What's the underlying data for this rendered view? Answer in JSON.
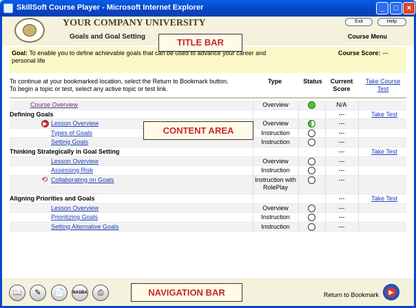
{
  "window": {
    "title": "SkillSoft Course Player - Microsoft Internet Explorer"
  },
  "header": {
    "company": "YOUR COMPANY UNIVERSITY",
    "course_title": "Goals and Goal Setting",
    "exit_label": "Exit",
    "help_label": "Help",
    "course_menu": "Course Menu"
  },
  "labels": {
    "title_bar": "TITLE BAR",
    "content_area": "CONTENT AREA",
    "navigation_bar": "NAVIGATION BAR"
  },
  "goal": {
    "label": "Goal:",
    "text": "To enable you to define achievable goals that can be used to advance your career and personal life",
    "score_label": "Course Score:",
    "score_value": "---"
  },
  "instructions": {
    "line1": "To continue at your bookmarked location, select the Return to Bookmark button.",
    "line2": "To begin a topic or test, select any active topic or test link."
  },
  "columns": {
    "type": "Type",
    "status": "Status",
    "current_score": "Current Score",
    "take_course_test": "Take Course Test"
  },
  "rows": [
    {
      "name": "Course Overview",
      "level": 0,
      "kind": "link-visited",
      "type": "Overview",
      "status": "complete",
      "score": "N/A",
      "take": ""
    },
    {
      "name": "Defining Goals",
      "level": 0,
      "kind": "section",
      "type": "",
      "status": "",
      "score": "---",
      "take": "Take Test"
    },
    {
      "name": "Lesson Overview",
      "level": 1,
      "kind": "link",
      "type": "Overview",
      "status": "in-progress",
      "score": "---",
      "take": "",
      "marker": "bookmark"
    },
    {
      "name": "Types of Goals",
      "level": 1,
      "kind": "link",
      "type": "Instruction",
      "status": "not-started",
      "score": "---",
      "take": ""
    },
    {
      "name": "Setting Goals",
      "level": 1,
      "kind": "link",
      "type": "Instruction",
      "status": "not-started",
      "score": "---",
      "take": ""
    },
    {
      "name": "Thinking Strategically in Goal Setting",
      "level": 0,
      "kind": "section",
      "type": "",
      "status": "",
      "score": "---",
      "take": "Take Test"
    },
    {
      "name": "Lesson Overview",
      "level": 1,
      "kind": "link",
      "type": "Overview",
      "status": "not-started",
      "score": "---",
      "take": ""
    },
    {
      "name": "Assessing Risk",
      "level": 1,
      "kind": "link",
      "type": "Instruction",
      "status": "not-started",
      "score": "---",
      "take": ""
    },
    {
      "name": "Collaborating on Goals",
      "level": 1,
      "kind": "link",
      "type": "Instruction with RolePlay",
      "status": "not-started",
      "score": "---",
      "take": "",
      "marker": "roleplay"
    },
    {
      "name": "Aligning Priorities and Goals",
      "level": 0,
      "kind": "section",
      "type": "",
      "status": "",
      "score": "---",
      "take": "Take Test"
    },
    {
      "name": "Lesson Overview",
      "level": 1,
      "kind": "link",
      "type": "Overview",
      "status": "not-started",
      "score": "---",
      "take": ""
    },
    {
      "name": "Prioritizing Goals",
      "level": 1,
      "kind": "link",
      "type": "Instruction",
      "status": "not-started",
      "score": "---",
      "take": ""
    },
    {
      "name": "Setting Alternative Goals",
      "level": 1,
      "kind": "link",
      "type": "Instruction",
      "status": "not-started",
      "score": "---",
      "take": ""
    }
  ],
  "nav": {
    "nasba_label": "NASBA",
    "return_label": "Return to Bookmark"
  },
  "colors": {
    "accent": "#1a3db5",
    "label_text": "#c4272d",
    "status_complete": "#4cc62a"
  }
}
